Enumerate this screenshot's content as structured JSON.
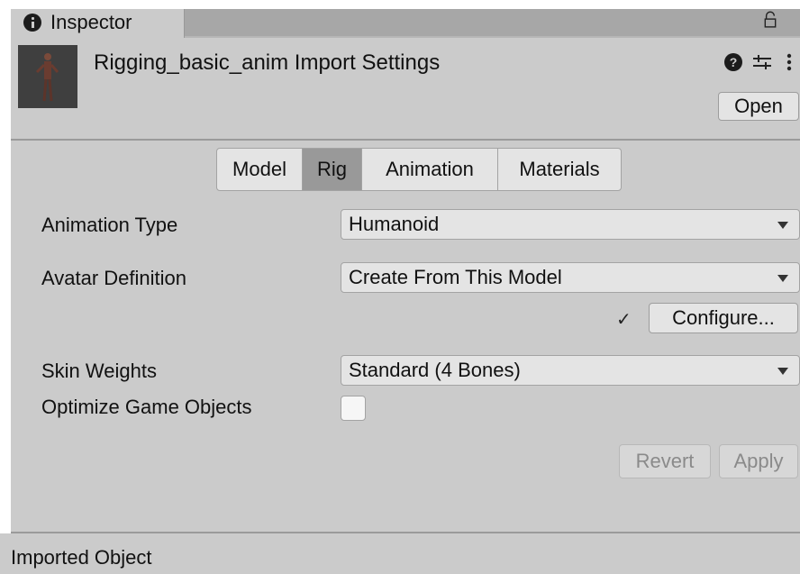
{
  "inspector": {
    "tab_title": "Inspector",
    "header": {
      "title": "Rigging_basic_anim Import Settings",
      "open_label": "Open",
      "help_glyph": "?",
      "icons": [
        "info-icon",
        "lock-icon",
        "help-icon",
        "presets-icon",
        "more-vert-icon"
      ]
    },
    "tabs": [
      {
        "label": "Model",
        "active": false
      },
      {
        "label": "Rig",
        "active": true
      },
      {
        "label": "Animation",
        "active": false
      },
      {
        "label": "Materials",
        "active": false
      }
    ],
    "rig": {
      "animation_type": {
        "label": "Animation Type",
        "value": "Humanoid"
      },
      "avatar_definition": {
        "label": "Avatar Definition",
        "value": "Create From This Model"
      },
      "configure": {
        "check": "✓",
        "label": "Configure..."
      },
      "skin_weights": {
        "label": "Skin Weights",
        "value": "Standard (4 Bones)"
      },
      "optimize_game_objects": {
        "label": "Optimize Game Objects",
        "checked": false
      }
    },
    "actions": {
      "revert_label": "Revert",
      "apply_label": "Apply"
    },
    "footer": {
      "label": "Imported Object"
    }
  },
  "colors": {
    "panel": "#cbcbcb",
    "tab_bar": "#a7a7a7",
    "active_tab": "#999999",
    "button": "#e4e4e4"
  }
}
